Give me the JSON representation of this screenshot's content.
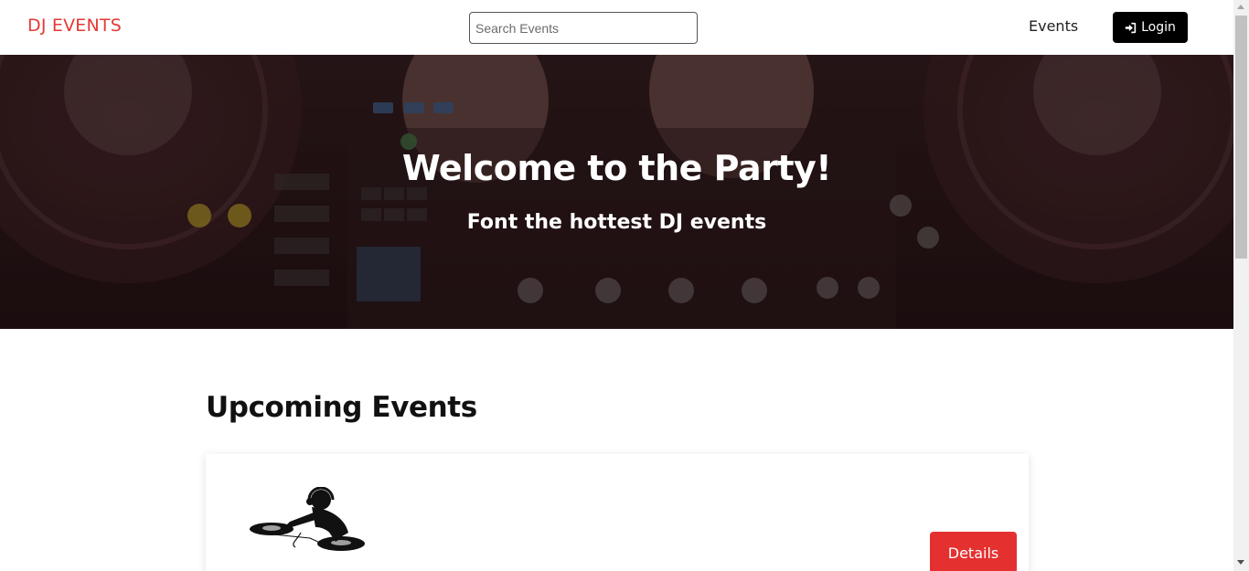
{
  "header": {
    "logo": "DJ EVENTS",
    "search_placeholder": "Search Events",
    "nav_events": "Events",
    "login_label": "Login",
    "login_icon": "sign-in-icon"
  },
  "hero": {
    "title": "Welcome to the Party!",
    "subtitle": "Font the hottest DJ events"
  },
  "main": {
    "section_title": "Upcoming Events",
    "events": [
      {
        "image_icon": "dj-turntable-icon",
        "details_label": "Details"
      }
    ]
  },
  "colors": {
    "brand": "#e53935",
    "details_button": "#e53030",
    "login_button": "#000000"
  }
}
